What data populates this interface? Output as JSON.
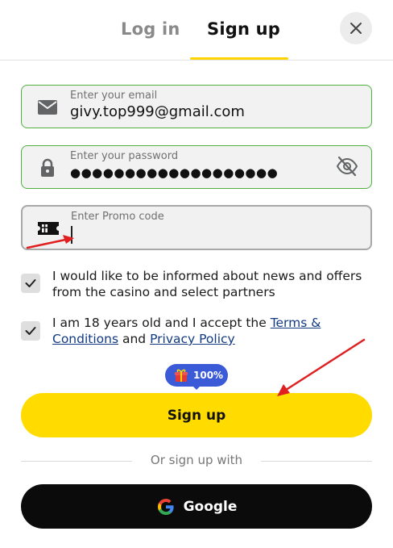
{
  "tabs": {
    "login": "Log in",
    "signup": "Sign up",
    "active": "signup"
  },
  "close_icon": "close-icon",
  "email": {
    "label": "Enter your email",
    "value": "givy.top999@gmail.com",
    "icon": "envelope-icon"
  },
  "password": {
    "label": "Enter your password",
    "value": "●●●●●●●●●●●●●●●●●●●",
    "icon": "lock-icon",
    "toggle_icon": "eye-off-icon"
  },
  "promo": {
    "label": "Enter Promo code",
    "value": "",
    "icon": "ticket-icon"
  },
  "consent_marketing": {
    "checked": true,
    "text": "I would like to be informed about news and offers from the casino and select partners"
  },
  "consent_terms": {
    "checked": true,
    "text_prefix": "I am 18 years old and I accept the ",
    "terms_link": "Terms & Conditions",
    "text_middle": " and ",
    "privacy_link": "Privacy Policy"
  },
  "bonus_badge": {
    "icon": "gift-icon",
    "value": "100%"
  },
  "signup_button": "Sign up",
  "divider": "Or sign up with",
  "google_button": {
    "label": "Google",
    "icon": "google-icon"
  },
  "colors": {
    "accent": "#ffdb00",
    "valid_border": "#52b043",
    "badge": "#3b5ad8",
    "annotation": "#e02020"
  }
}
